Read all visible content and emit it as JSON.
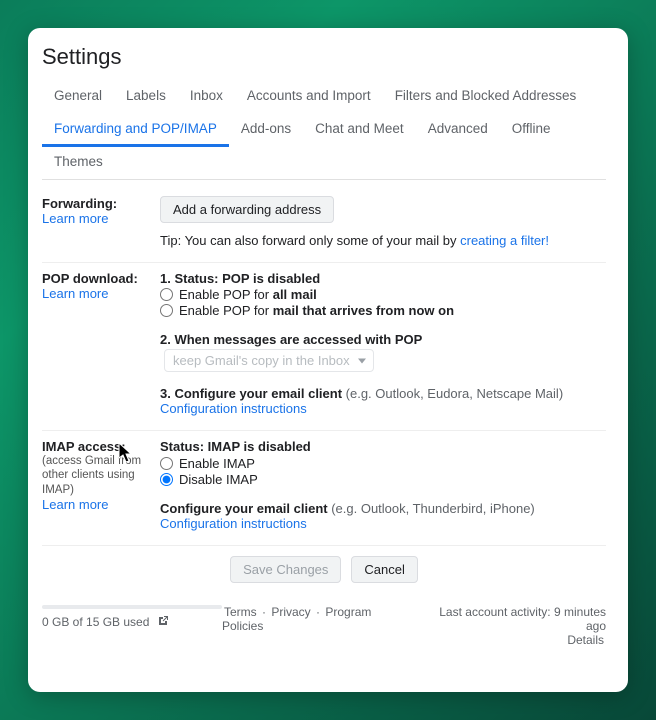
{
  "title": "Settings",
  "tabs": {
    "general": "General",
    "labels": "Labels",
    "inbox": "Inbox",
    "accounts": "Accounts and Import",
    "filters": "Filters and Blocked Addresses",
    "forwarding": "Forwarding and POP/IMAP",
    "addons": "Add-ons",
    "chat": "Chat and Meet",
    "advanced": "Advanced",
    "offline": "Offline",
    "themes": "Themes"
  },
  "forwarding": {
    "heading": "Forwarding:",
    "learn": "Learn more",
    "add_btn": "Add a forwarding address",
    "tip_prefix": "Tip: You can also forward only some of your mail by ",
    "tip_link": "creating a filter!"
  },
  "pop": {
    "heading": "POP download:",
    "learn": "Learn more",
    "status_label": "1. Status: ",
    "status_value": "POP is disabled",
    "opt1_prefix": "Enable POP for ",
    "opt1_bold": "all mail",
    "opt2_prefix": "Enable POP for ",
    "opt2_bold": "mail that arrives from now on",
    "when_label": "2. When messages are accessed with POP",
    "when_select": "keep Gmail's copy in the Inbox",
    "configure_label": "3. Configure your email client ",
    "configure_note": "(e.g. Outlook, Eudora, Netscape Mail)",
    "config_link": "Configuration instructions"
  },
  "imap": {
    "heading": "IMAP access:",
    "sub": "(access Gmail from other clients using IMAP)",
    "learn": "Learn more",
    "status_label": "Status: ",
    "status_value": "IMAP is disabled",
    "enable": "Enable IMAP",
    "disable": "Disable IMAP",
    "configure_label": "Configure your email client ",
    "configure_note": "(e.g. Outlook, Thunderbird, iPhone)",
    "config_link": "Configuration instructions"
  },
  "actions": {
    "save": "Save Changes",
    "cancel": "Cancel"
  },
  "footer": {
    "storage": "0 GB of 15 GB used",
    "terms": "Terms",
    "privacy": "Privacy",
    "policies": "Program Policies",
    "activity": "Last account activity: 9 minutes ago",
    "details": "Details"
  }
}
